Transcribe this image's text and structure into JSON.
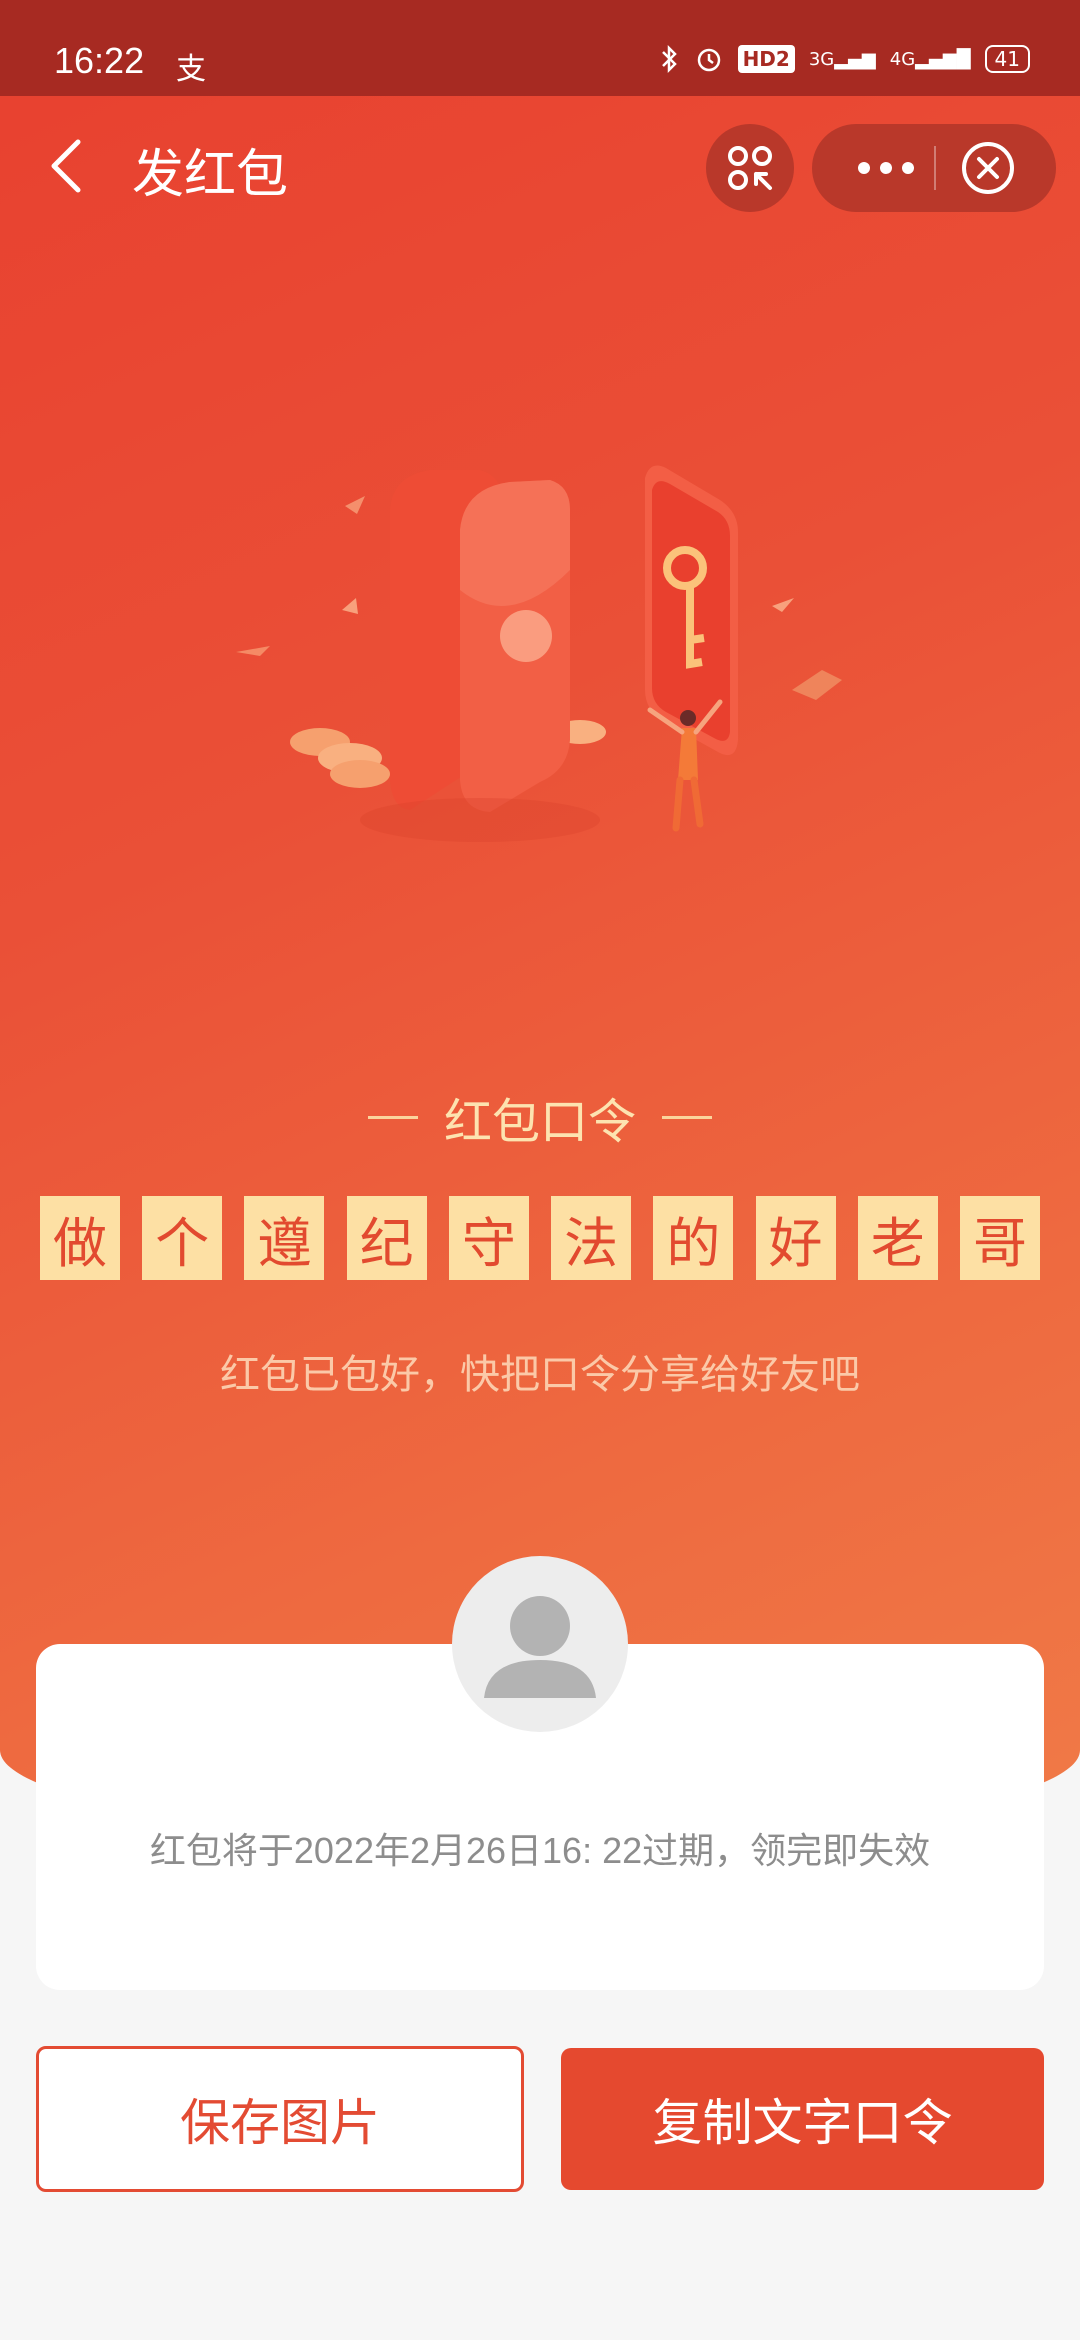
{
  "status_bar": {
    "time": "16:22",
    "alipay_glyph": "支",
    "hd": "HD2",
    "net1": "3G",
    "net2": "4G",
    "battery": "41"
  },
  "nav": {
    "title": "发红包"
  },
  "password": {
    "heading": "红包口令",
    "chars": [
      "做",
      "个",
      "遵",
      "纪",
      "守",
      "法",
      "的",
      "好",
      "老",
      "哥"
    ],
    "subtitle": "红包已包好，快把口令分享给好友吧"
  },
  "card": {
    "expire_text": "红包将于2022年2月26日16: 22过期，领完即失效"
  },
  "buttons": {
    "save": "保存图片",
    "copy": "复制文字口令"
  },
  "colors": {
    "accent": "#e5492f",
    "status_bar": "#a72a22",
    "password_tile": "#fde0a4"
  },
  "icons": [
    "back-icon",
    "scan-icon",
    "more-icon",
    "close-icon",
    "bluetooth-icon",
    "alarm-icon",
    "avatar-placeholder-icon"
  ]
}
